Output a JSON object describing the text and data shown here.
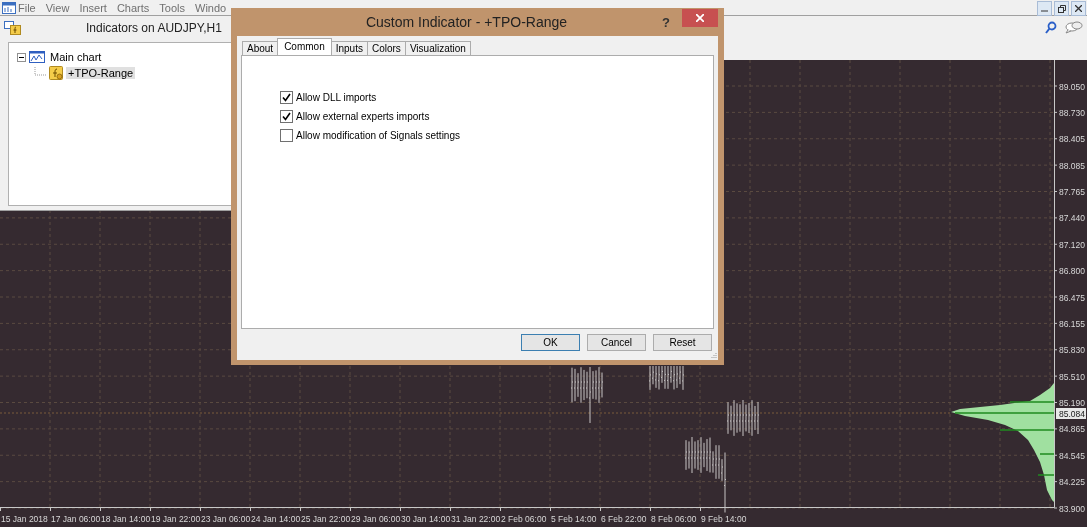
{
  "menu": [
    {
      "label": "File"
    },
    {
      "label": "View"
    },
    {
      "label": "Insert"
    },
    {
      "label": "Charts"
    },
    {
      "label": "Tools"
    },
    {
      "label": "Windo"
    }
  ],
  "indicators_window": {
    "title": "Indicators on AUDJPY,H1",
    "tree": [
      {
        "label": "Main chart",
        "expanded": true,
        "selected": false,
        "children": [
          {
            "label": "+TPO-Range",
            "selected": true
          }
        ]
      }
    ]
  },
  "chart": {
    "price_labels": [
      "89.050",
      "88.730",
      "88.405",
      "88.085",
      "87.765",
      "87.440",
      "87.120",
      "86.800",
      "86.475",
      "86.155",
      "85.830",
      "85.510",
      "85.190",
      "84.865",
      "84.545",
      "84.225",
      "83.900"
    ],
    "current_price": "85.084",
    "time_labels": [
      "15 Jan 2018",
      "17 Jan 06:00",
      "18 Jan 14:00",
      "19 Jan 22:00",
      "23 Jan 06:00",
      "24 Jan 14:00",
      "25 Jan 22:00",
      "29 Jan 06:00",
      "30 Jan 14:00",
      "31 Jan 22:00",
      "2 Feb 06:00",
      "5 Feb 14:00",
      "6 Feb 22:00",
      "8 Feb 06:00",
      "9 Feb 14:00"
    ]
  },
  "dialog": {
    "title": "Custom Indicator - +TPO-Range",
    "help": "?",
    "tabs": [
      {
        "label": "About",
        "selected": false
      },
      {
        "label": "Common",
        "selected": true
      },
      {
        "label": "Inputs",
        "selected": false
      },
      {
        "label": "Colors",
        "selected": false
      },
      {
        "label": "Visualization",
        "selected": false
      }
    ],
    "options": [
      {
        "label": "Allow DLL imports",
        "checked": true
      },
      {
        "label": "Allow external experts imports",
        "checked": true
      },
      {
        "label": "Allow modification of Signals settings",
        "checked": false
      }
    ],
    "buttons": [
      {
        "label": "OK",
        "default": true
      },
      {
        "label": "Cancel",
        "default": false
      },
      {
        "label": "Reset",
        "default": false
      }
    ]
  }
}
